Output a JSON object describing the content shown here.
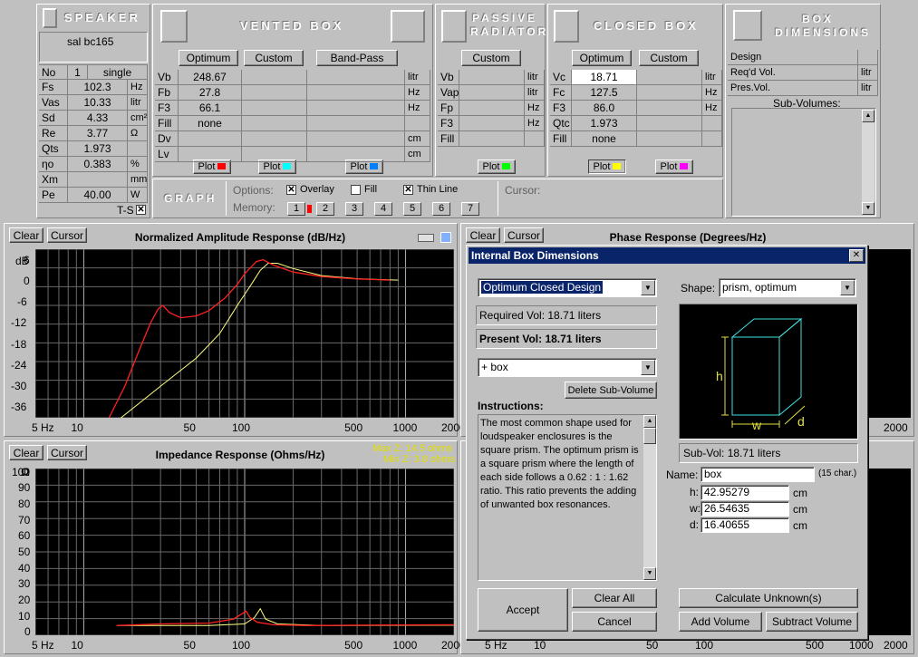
{
  "speaker": {
    "header": "SPEAKER",
    "name": "sal bc165",
    "no_label": "No",
    "no_value": "1",
    "no_mode": "single",
    "params": [
      {
        "label": "Fs",
        "value": "102.3",
        "unit": "Hz"
      },
      {
        "label": "Vas",
        "value": "10.33",
        "unit": "litr"
      },
      {
        "label": "Sd",
        "value": "4.33",
        "unit": "cm²"
      },
      {
        "label": "Re",
        "value": "3.77",
        "unit": "Ω"
      },
      {
        "label": "Qts",
        "value": "1.973",
        "unit": ""
      },
      {
        "label": "ηo",
        "value": "0.383",
        "unit": "%"
      },
      {
        "label": "Xm",
        "value": "",
        "unit": "mm"
      },
      {
        "label": "Pe",
        "value": "40.00",
        "unit": "W"
      }
    ],
    "ts_label": "T-S",
    "ts_checked": "✕"
  },
  "vented": {
    "header": "VENTED BOX",
    "buttons": [
      "Optimum",
      "Custom",
      "Band-Pass"
    ],
    "rows": [
      {
        "label": "Vb",
        "value": "248.67",
        "unit": "litr"
      },
      {
        "label": "Fb",
        "value": "27.8",
        "unit": "Hz"
      },
      {
        "label": "F3",
        "value": "66.1",
        "unit": "Hz"
      },
      {
        "label": "Fill",
        "value": "none",
        "unit": ""
      },
      {
        "label": "Dv",
        "value": "",
        "unit": "cm"
      },
      {
        "label": "Lv",
        "value": "",
        "unit": "cm"
      }
    ],
    "plot_label": "Plot",
    "plot_colors": [
      "#ff0000",
      "#00ffff",
      "#0080ff"
    ]
  },
  "passive": {
    "header_line1": "PASSIVE",
    "header_line2": "RADIATOR",
    "button": "Custom",
    "rows": [
      {
        "label": "Vb",
        "unit": "litr"
      },
      {
        "label": "Vap",
        "unit": "litr"
      },
      {
        "label": "Fp",
        "unit": "Hz"
      },
      {
        "label": "F3",
        "unit": "Hz"
      },
      {
        "label": "Fill",
        "unit": ""
      }
    ],
    "plot_label": "Plot",
    "plot_color": "#00ff00"
  },
  "closed": {
    "header": "CLOSED BOX",
    "buttons": [
      "Optimum",
      "Custom"
    ],
    "rows": [
      {
        "label": "Vc",
        "value": "18.71",
        "unit": "litr"
      },
      {
        "label": "Fc",
        "value": "127.5",
        "unit": "Hz"
      },
      {
        "label": "F3",
        "value": "86.0",
        "unit": "Hz"
      },
      {
        "label": "Qtc",
        "value": "1.973",
        "unit": ""
      },
      {
        "label": "Fill",
        "value": "none",
        "unit": ""
      }
    ],
    "plot_label": "Plot",
    "plot_colors": [
      "#ffff00",
      "#ff00ff"
    ]
  },
  "boxdim": {
    "header_line1": "BOX",
    "header_line2": "DIMENSIONS",
    "rows": [
      {
        "label": "Design",
        "unit": ""
      },
      {
        "label": "Req'd Vol.",
        "unit": "litr"
      },
      {
        "label": "Pres.Vol.",
        "unit": "litr"
      }
    ],
    "subvolumes_label": "Sub-Volumes:"
  },
  "graph": {
    "header": "GRAPH",
    "options_label": "Options:",
    "overlay_label": "Overlay",
    "fill_label": "Fill",
    "thinline_label": "Thin Line",
    "check_mark": "✕",
    "memory_label": "Memory:",
    "memory": [
      "1",
      "2",
      "3",
      "4",
      "5",
      "6",
      "7"
    ],
    "cursor_label": "Cursor:"
  },
  "plots": {
    "clear": "Clear",
    "cursor": "Cursor",
    "amplitude": {
      "title": "Normalized Amplitude Response (dB/Hz)",
      "y_unit": "dB",
      "y_ticks": [
        "6",
        "0",
        "-6",
        "-12",
        "-18",
        "-24",
        "-30",
        "-36"
      ],
      "x_ticks": [
        "5 Hz",
        "10",
        "50",
        "100",
        "500",
        "1000",
        "2000"
      ]
    },
    "phase": {
      "title": "Phase Response (Degrees/Hz)",
      "x_ticks": [
        "2000"
      ]
    },
    "impedance": {
      "title": "Impedance Response (Ohms/Hz)",
      "max_z": "Max Z: 14.5 ohms",
      "min_z": "Min Z: 3.8 ohms",
      "y_unit": "Ω",
      "y_ticks": [
        "100",
        "90",
        "80",
        "70",
        "60",
        "50",
        "40",
        "30",
        "20",
        "10",
        "0"
      ],
      "x_ticks": [
        "5 Hz",
        "10",
        "50",
        "100",
        "500",
        "1000",
        "2000"
      ]
    },
    "bottom_right_x_ticks": [
      "5 Hz",
      "10",
      "50",
      "100",
      "500",
      "1000",
      "2000"
    ]
  },
  "dialog": {
    "title": "Internal Box Dimensions",
    "close": "✕",
    "design_select": "Optimum Closed Design",
    "required_vol": "Required Vol: 18.71 liters",
    "present_vol": "Present Vol: 18.71 liters",
    "subvol_select": "+  box",
    "delete_btn": "Delete Sub-Volume",
    "instructions_label": "Instructions:",
    "instructions": "The most common shape used for loudspeaker enclosures is the square prism. The optimum prism is a square prism where the length of each side follows a 0.62 : 1 : 1.62 ratio. This ratio prevents the adding of unwanted box resonances.",
    "shape_label": "Shape:",
    "shape_select": "prism, optimum",
    "dim_h": "h",
    "dim_w": "w",
    "dim_d": "d",
    "subvol_text": "Sub-Vol: 18.71 liters",
    "name_label": "Name:",
    "name_value": "box",
    "name_hint": "(15 char.)",
    "fields": [
      {
        "label": "h:",
        "value": "42.95279",
        "unit": "cm"
      },
      {
        "label": "w:",
        "value": "26.54635",
        "unit": "cm"
      },
      {
        "label": "d:",
        "value": "16.40655",
        "unit": "cm"
      }
    ],
    "accept": "Accept",
    "clear_all": "Clear All",
    "cancel": "Cancel",
    "calc": "Calculate Unknown(s)",
    "add_vol": "Add Volume",
    "sub_vol": "Subtract Volume",
    "title_bar_color": "#0a246a"
  }
}
